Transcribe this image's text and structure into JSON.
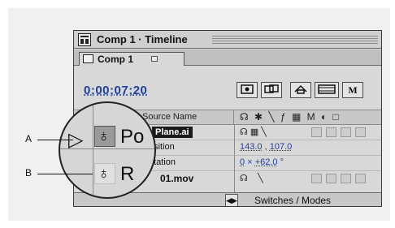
{
  "window": {
    "title": "Comp 1 · Timeline"
  },
  "tab": {
    "label": "Comp 1"
  },
  "timecode": "0;00;07;20",
  "toolbar": {
    "m_label": "M"
  },
  "columns": {
    "source_name": "Source Name",
    "switches_icons": "☊ ✱ ╲ ƒ ▦ M ◐ □"
  },
  "layers": [
    {
      "name": "Plane.ai"
    },
    {
      "name": "01.mov"
    }
  ],
  "properties": [
    {
      "name": "Position",
      "shown": "osition",
      "x": "143.0",
      "sep": ",",
      "y": "107.0"
    },
    {
      "name": "Rotation",
      "shown": "otation",
      "turns": "0",
      "times": "×",
      "degrees": "+62.0",
      "deg_symbol": "°"
    }
  ],
  "bottom": {
    "switches_modes": "Switches / Modes"
  },
  "magnifier": {
    "row1_text": "Po",
    "row2_text": "R"
  },
  "callouts": {
    "a": "A",
    "b": "B"
  }
}
